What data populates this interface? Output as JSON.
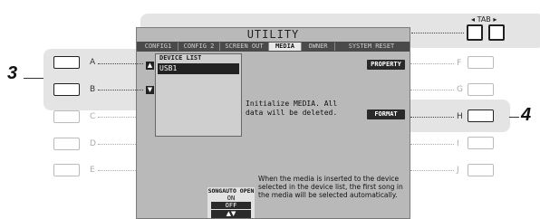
{
  "lcd": {
    "title": "UTILITY",
    "tabs": [
      "CONFIG1",
      "CONFIG 2",
      "SCREEN OUT",
      "MEDIA",
      "OWNER",
      "SYSTEM RESET"
    ],
    "active_tab": "MEDIA",
    "device_list": {
      "header": "DEVICE LIST",
      "items": [
        "USB1"
      ],
      "selected": "USB1"
    },
    "property_label": "PROPERTY",
    "initialize_text": "Initialize MEDIA. All data will be deleted.",
    "format_label": "FORMAT",
    "song_auto_open": {
      "label": "SONGAUTO OPEN",
      "on": "ON",
      "off": "OFF",
      "selected": "OFF"
    },
    "description": "When the media is inserted to the device selected in the device list, the first song in the media will be selected automatically."
  },
  "tab_buttons_label": "TAB",
  "tab_arrows": {
    "left": "◂",
    "right": "▸"
  },
  "left_buttons": [
    "A",
    "B",
    "C",
    "D",
    "E"
  ],
  "right_buttons": [
    "F",
    "G",
    "H",
    "I",
    "J"
  ],
  "callouts": [
    "3",
    "4"
  ]
}
